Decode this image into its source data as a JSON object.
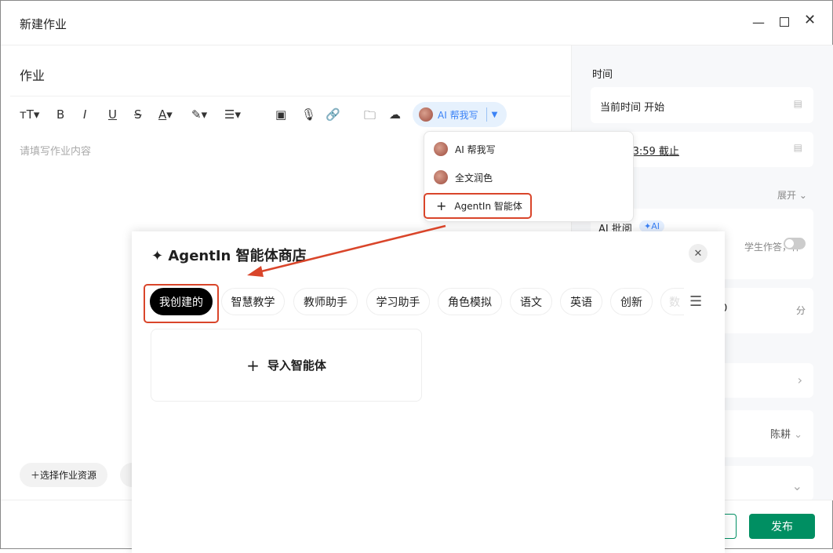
{
  "window": {
    "title": "新建作业",
    "controls": [
      "minimize",
      "maximize",
      "close"
    ]
  },
  "editor": {
    "title_value": "作业",
    "placeholder": "请填写作业内容",
    "toolbar": {
      "ai_button": "AI 帮我写"
    },
    "bottom_buttons": [
      "选择作业资源"
    ]
  },
  "ai_dropdown": {
    "items": [
      "AI 帮我写",
      "全文润色",
      "AgentIn 智能体"
    ]
  },
  "right_panel": {
    "time_label": "时间",
    "start": "当前时间 开始",
    "end": "9/15 23:59 截止",
    "expand": "展开",
    "ai_review": "AI 批阅",
    "ai_badge": "AI",
    "ai_desc": "学生作答，作",
    "score_value": "0",
    "score_unit": "分",
    "owner": "陈耕"
  },
  "footer": {
    "publish": "发布"
  },
  "modal": {
    "title": "AgentIn 智能体商店",
    "tabs": [
      "我创建的",
      "智慧教学",
      "教师助手",
      "学习助手",
      "角色模拟",
      "语文",
      "英语",
      "创新",
      "数"
    ],
    "import_label": "导入智能体"
  },
  "colors": {
    "accent": "#008f62",
    "highlight": "#d9452a",
    "ai_blue": "#3b82f6"
  }
}
